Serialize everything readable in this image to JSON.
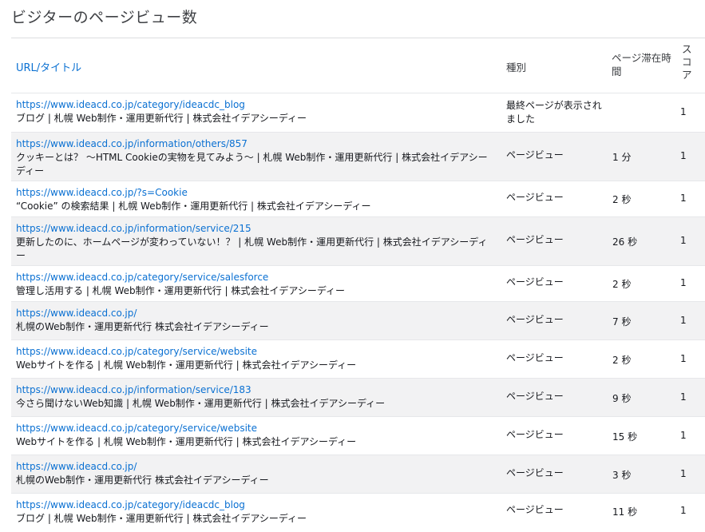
{
  "page": {
    "title": "ビジターのページビュー数"
  },
  "table": {
    "headers": {
      "url_title": "URL/タイトル",
      "type": "種別",
      "time": "ページ滞在時間",
      "score": "スコア"
    },
    "rows": [
      {
        "url": "https://www.ideacd.co.jp/category/ideacdc_blog",
        "title": "ブログ | 札幌 Web制作・運用更新代行 | 株式会社イデアシーディー",
        "type": "最終ページが表示されました",
        "time": "",
        "score": "1"
      },
      {
        "url": "https://www.ideacd.co.jp/information/others/857",
        "title": "クッキーとは？ 〜HTML Cookieの実物を見てみよう〜 | 札幌 Web制作・運用更新代行 | 株式会社イデアシーディー",
        "type": "ページビュー",
        "time": "1 分",
        "score": "1"
      },
      {
        "url": "https://www.ideacd.co.jp/?s=Cookie",
        "title": "“Cookie” の検索結果 | 札幌 Web制作・運用更新代行 | 株式会社イデアシーディー",
        "type": "ページビュー",
        "time": "2 秒",
        "score": "1"
      },
      {
        "url": "https://www.ideacd.co.jp/information/service/215",
        "title": "更新したのに、ホームページが変わっていない！？ | 札幌 Web制作・運用更新代行 | 株式会社イデアシーディー",
        "type": "ページビュー",
        "time": "26 秒",
        "score": "1"
      },
      {
        "url": "https://www.ideacd.co.jp/category/service/salesforce",
        "title": "管理し活用する | 札幌 Web制作・運用更新代行 | 株式会社イデアシーディー",
        "type": "ページビュー",
        "time": "2 秒",
        "score": "1"
      },
      {
        "url": "https://www.ideacd.co.jp/",
        "title": "札幌のWeb制作・運用更新代行 株式会社イデアシーディー",
        "type": "ページビュー",
        "time": "7 秒",
        "score": "1"
      },
      {
        "url": "https://www.ideacd.co.jp/category/service/website",
        "title": "Webサイトを作る | 札幌 Web制作・運用更新代行 | 株式会社イデアシーディー",
        "type": "ページビュー",
        "time": "2 秒",
        "score": "1"
      },
      {
        "url": "https://www.ideacd.co.jp/information/service/183",
        "title": "今さら聞けないWeb知識 | 札幌 Web制作・運用更新代行 | 株式会社イデアシーディー",
        "type": "ページビュー",
        "time": "9 秒",
        "score": "1"
      },
      {
        "url": "https://www.ideacd.co.jp/category/service/website",
        "title": "Webサイトを作る | 札幌 Web制作・運用更新代行 | 株式会社イデアシーディー",
        "type": "ページビュー",
        "time": "15 秒",
        "score": "1"
      },
      {
        "url": "https://www.ideacd.co.jp/",
        "title": "札幌のWeb制作・運用更新代行 株式会社イデアシーディー",
        "type": "ページビュー",
        "time": "3 秒",
        "score": "1"
      },
      {
        "url": "https://www.ideacd.co.jp/category/ideacdc_blog",
        "title": "ブログ | 札幌 Web制作・運用更新代行 | 株式会社イデアシーディー",
        "type": "ページビュー",
        "time": "11 秒",
        "score": "1"
      }
    ]
  }
}
